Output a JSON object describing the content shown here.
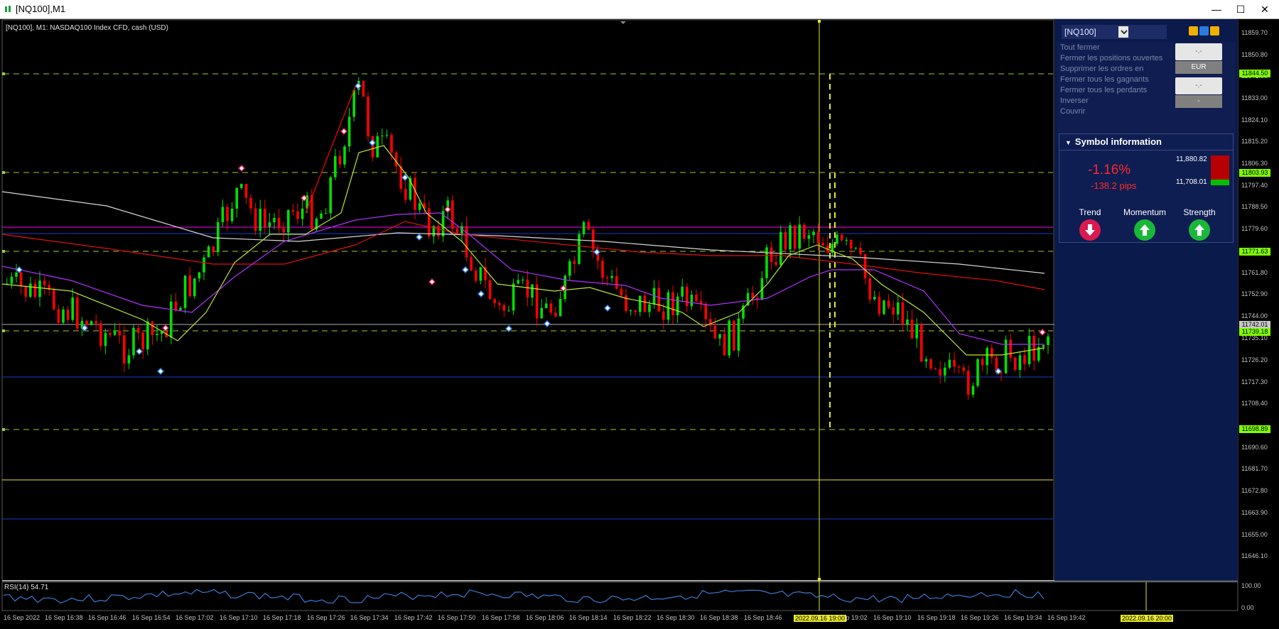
{
  "window": {
    "title": "[NQ100],M1",
    "minimize": "—",
    "maximize": "☐",
    "close": "✕"
  },
  "chart": {
    "header": "[NQ100], M1:  NASDAQ100 Index CFD, cash (USD)",
    "rsi_header": "RSI(14) 54.71",
    "price_axis": [
      "11859.70",
      "11850.80",
      "11841.90",
      "11833.00",
      "11824.10",
      "11815.20",
      "11806.30",
      "11797.40",
      "11788.50",
      "11779.60",
      "11761.80",
      "11752.90",
      "11744.00",
      "11735.10",
      "11726.20",
      "11717.30",
      "11708.40",
      "11690.60",
      "11681.70",
      "11672.80",
      "11663.90",
      "11655.00",
      "11646.10"
    ],
    "price_tags": [
      {
        "text": "11844.50",
        "color": "#7fff00"
      },
      {
        "text": "11803.93",
        "color": "#7fff00"
      },
      {
        "text": "11771.63",
        "color": "#7fff00"
      },
      {
        "text": "11742.01",
        "color": "#c8c8c8"
      },
      {
        "text": "11739.18",
        "color": "#7fff00"
      },
      {
        "text": "11698.89",
        "color": "#7fff00"
      }
    ],
    "rsi_axis": [
      "100.00",
      "0.00"
    ],
    "time_axis": [
      "16 Sep 2022",
      "16 Sep 16:38",
      "16 Sep 16:46",
      "16 Sep 16:54",
      "16 Sep 17:02",
      "16 Sep 17:10",
      "16 Sep 17:18",
      "16 Sep 17:26",
      "16 Sep 17:34",
      "16 Sep 17:42",
      "16 Sep 17:50",
      "16 Sep 17:58",
      "16 Sep 18:06",
      "16 Sep 18:14",
      "16 Sep 18:22",
      "16 Sep 18:30",
      "16 Sep 18:38",
      "16 Sep 18:46",
      "16 Sep 19:02",
      "16 Sep 19:10",
      "16 Sep 19:18",
      "16 Sep 19:26",
      "16 Sep 19:34",
      "16 Sep 19:42"
    ],
    "crosshair_time": "2022.09.16 19:00",
    "panel_time": "2022.09.16 20:00",
    "colors": {
      "bull": "#00e000",
      "bear": "#ff0000",
      "fib": "#9acd32",
      "crosshair": "#e8e82a",
      "ma_white": "#d8d8d8",
      "ma_red": "#e01010",
      "ma_purple": "#b030ff",
      "ma_green": "#b8e830",
      "rsi": "#3a7bd5",
      "magenta": "#ff00ff",
      "blue": "#1a3ccc"
    }
  },
  "panel": {
    "symbol": "[NQ100]",
    "trade_items": [
      "Tout fermer",
      "Fermer les positions ouvertes",
      "Supprimer les ordres en",
      "Fermer tous les gagnants",
      "Fermer tous les perdants",
      "Inverser",
      "Couvrir"
    ],
    "btn_top": "-.-",
    "btn_currency": "EUR",
    "btn_bottom": "-.-",
    "btn_dash": "-",
    "symbol_info": {
      "title": "Symbol information",
      "change_pct": "-1.16%",
      "change_pips": "-138.2 pips",
      "high": "11,880.82",
      "low": "11,708.01",
      "trend_label": "Trend",
      "momentum_label": "Momentum",
      "strength_label": "Strength",
      "trend": "down",
      "momentum": "up",
      "strength": "up"
    }
  }
}
